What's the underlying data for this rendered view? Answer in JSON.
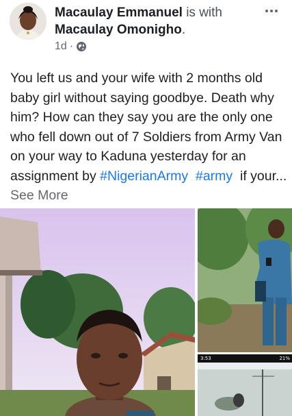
{
  "post": {
    "author_name": "Macaulay Emmanuel",
    "with_text": "is with",
    "tagged_name": "Macaulay Omonigho",
    "tagged_suffix": ".",
    "time": "1d",
    "separator": "·",
    "visibility_icon": "globe-icon",
    "more_icon": "more-options-icon",
    "text_main": "You left us and your wife with 2 months old baby girl without saying goodbye. Death why him? How can they say you are the only one who fell down out of 7 Soldiers from Army Van on your way to Kaduna yesterday for an assignment by ",
    "hashtag_1": "#NigerianArmy",
    "hashtag_2": "#army",
    "text_tail": "if your...",
    "see_more": "See More"
  },
  "photos": {
    "small_bottom": {
      "status_time": "3:53",
      "status_right": "21%"
    }
  },
  "colors": {
    "link": "#1877f2",
    "muted": "#65676b",
    "text": "#1c1e21"
  }
}
